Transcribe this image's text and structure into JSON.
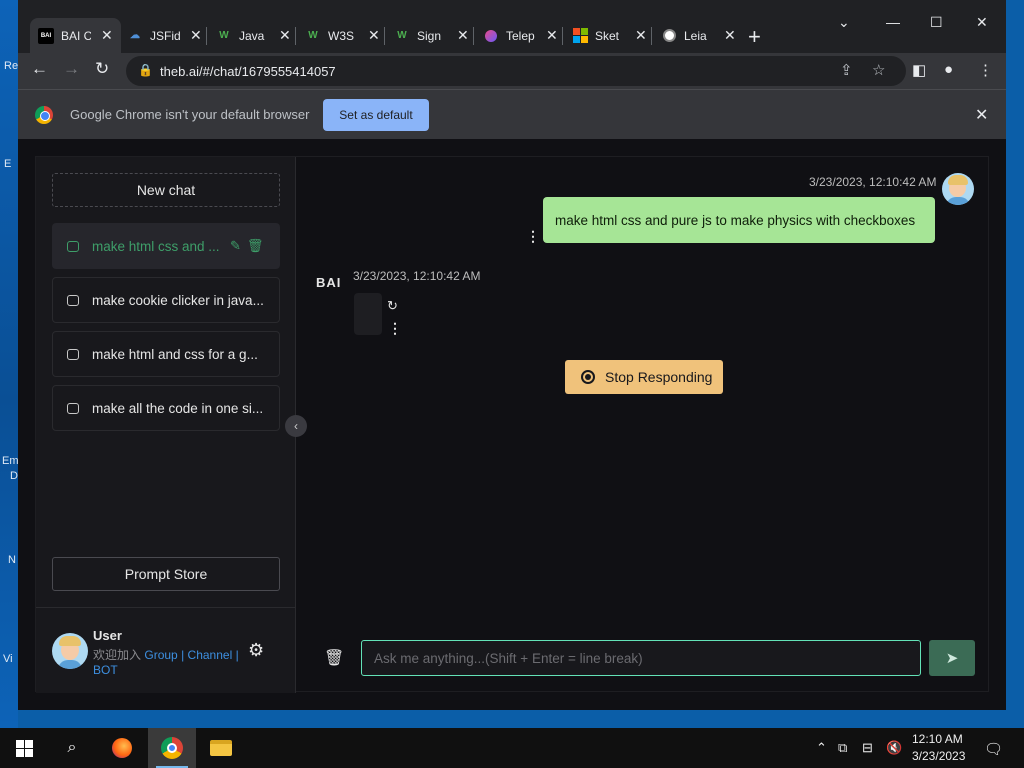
{
  "desktop": {
    "glyphs": [
      "Re",
      "E",
      "Em",
      "D",
      "N",
      "Vi"
    ]
  },
  "tabs": [
    {
      "title": "BAI C",
      "favicon": "BAI",
      "active": true
    },
    {
      "title": "JSFid",
      "favicon": "cloud"
    },
    {
      "title": "Java",
      "favicon": "W"
    },
    {
      "title": "W3S",
      "favicon": "W"
    },
    {
      "title": "Sign",
      "favicon": "W"
    },
    {
      "title": "Telep",
      "favicon": "telepathy"
    },
    {
      "title": "Sket",
      "favicon": "microsoft"
    },
    {
      "title": "Leia",
      "favicon": "globe"
    }
  ],
  "toolbar": {
    "url": "theb.ai/#/chat/1679555414057"
  },
  "infobar": {
    "message": "Google Chrome isn't your default browser",
    "button": "Set as default"
  },
  "sidebar": {
    "new_chat": "New chat",
    "history": [
      {
        "label": "make html css and ...",
        "active": true
      },
      {
        "label": "make cookie clicker in java..."
      },
      {
        "label": "make html and css for a g..."
      },
      {
        "label": "make all the code in one si..."
      }
    ],
    "prompt_store": "Prompt Store",
    "user": {
      "name": "User",
      "prefix": "欢迎加入",
      "link_group": "Group",
      "sep1": "|",
      "link_channel": "Channel",
      "sep2": "|",
      "link_bot": "BOT"
    }
  },
  "chat": {
    "user_timestamp": "3/23/2023, 12:10:42 AM",
    "user_message": "make html css and pure js to make physics with checkboxes",
    "bot_label": "BAI",
    "bot_timestamp": "3/23/2023, 12:10:42 AM",
    "stop_button": "Stop Responding",
    "input_placeholder": "Ask me anything...(Shift + Enter = line break)"
  },
  "taskbar": {
    "time": "12:10 AM",
    "date": "3/23/2023"
  },
  "colors": {
    "accent_green": "#3e9e69",
    "user_bubble": "#a6e596",
    "stop_button": "#f0c27b",
    "infobar_button": "#8ab4f8"
  }
}
